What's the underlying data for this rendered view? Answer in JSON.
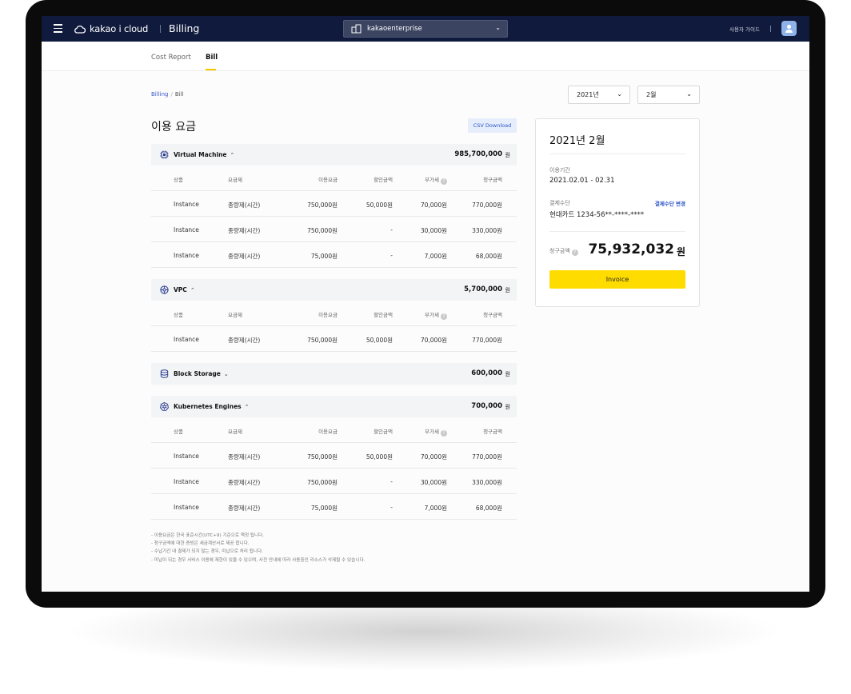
{
  "header": {
    "logo_text": "kakao i cloud",
    "app_title": "Billing",
    "org_name": "kakaoenterprise",
    "guide_label": "사용자 가이드"
  },
  "tabs": [
    {
      "label": "Cost Report",
      "active": false
    },
    {
      "label": "Bill",
      "active": true
    }
  ],
  "breadcrumb": {
    "root": "Billing",
    "separator": "/",
    "current": "Bill"
  },
  "filters": {
    "year": "2021년",
    "month": "2월"
  },
  "main": {
    "title": "이용 요금",
    "csv_button": "CSV Download",
    "currency_unit": "원",
    "columns": [
      "상품",
      "요금제",
      "이용요금",
      "할인금액",
      "부가세",
      "청구금액"
    ],
    "sections": [
      {
        "name": "Virtual Machine",
        "caret": "⌃",
        "total": "985,700,000",
        "icon": "chip-icon",
        "expanded": true,
        "rows": [
          [
            "Instance",
            "종량제(시간)",
            "750,000원",
            "50,000원",
            "70,000원",
            "770,000원"
          ],
          [
            "Instance",
            "종량제(시간)",
            "750,000원",
            "-",
            "30,000원",
            "330,000원"
          ],
          [
            "Instance",
            "종량제(시간)",
            "75,000원",
            "-",
            "7,000원",
            "68,000원"
          ]
        ]
      },
      {
        "name": "VPC",
        "caret": "⌃",
        "total": "5,700,000",
        "icon": "network-icon",
        "expanded": true,
        "rows": [
          [
            "Instance",
            "종량제(시간)",
            "750,000원",
            "50,000원",
            "70,000원",
            "770,000원"
          ]
        ]
      },
      {
        "name": "Block Storage",
        "caret": "⌄",
        "total": "600,000",
        "icon": "storage-icon",
        "expanded": false,
        "rows": []
      },
      {
        "name": "Kubernetes Engines",
        "caret": "⌃",
        "total": "700,000",
        "icon": "kubernetes-icon",
        "expanded": true,
        "rows": [
          [
            "Instance",
            "종량제(시간)",
            "750,000원",
            "50,000원",
            "70,000원",
            "770,000원"
          ],
          [
            "Instance",
            "종량제(시간)",
            "750,000원",
            "-",
            "30,000원",
            "330,000원"
          ],
          [
            "Instance",
            "종량제(시간)",
            "75,000원",
            "-",
            "7,000원",
            "68,000원"
          ]
        ]
      }
    ],
    "notes": [
      "- 이용요금은 한국 표준시간(UTC+9) 기준으로 책정 됩니다.",
      "- 청구금액에 대한 증빙은 세금계산서로 제공 합니다.",
      "- 수납기간 내 결제가 되지 않는 경우, 미납으로 처리 됩니다.",
      "- 미납이 되는 경우 서비스 이용에 제한이 있을 수 있으며, 사전 안내에 따라 사용중인 리소스가 삭제될 수 있습니다."
    ]
  },
  "summary": {
    "title": "2021년 2월",
    "period_label": "이용기간",
    "period_value": "2021.02.01 - 02.31",
    "payment_label": "결제수단",
    "payment_change": "결제수단 변경",
    "payment_value": "현대카드 1234-56**-****-****",
    "total_label": "청구금액",
    "total_amount": "75,932,032",
    "total_unit": "원",
    "invoice_button": "Invoice"
  },
  "colors": {
    "header_bg": "#0f1a3c",
    "accent_yellow": "#ffdc00",
    "link_blue": "#2d55c8"
  }
}
